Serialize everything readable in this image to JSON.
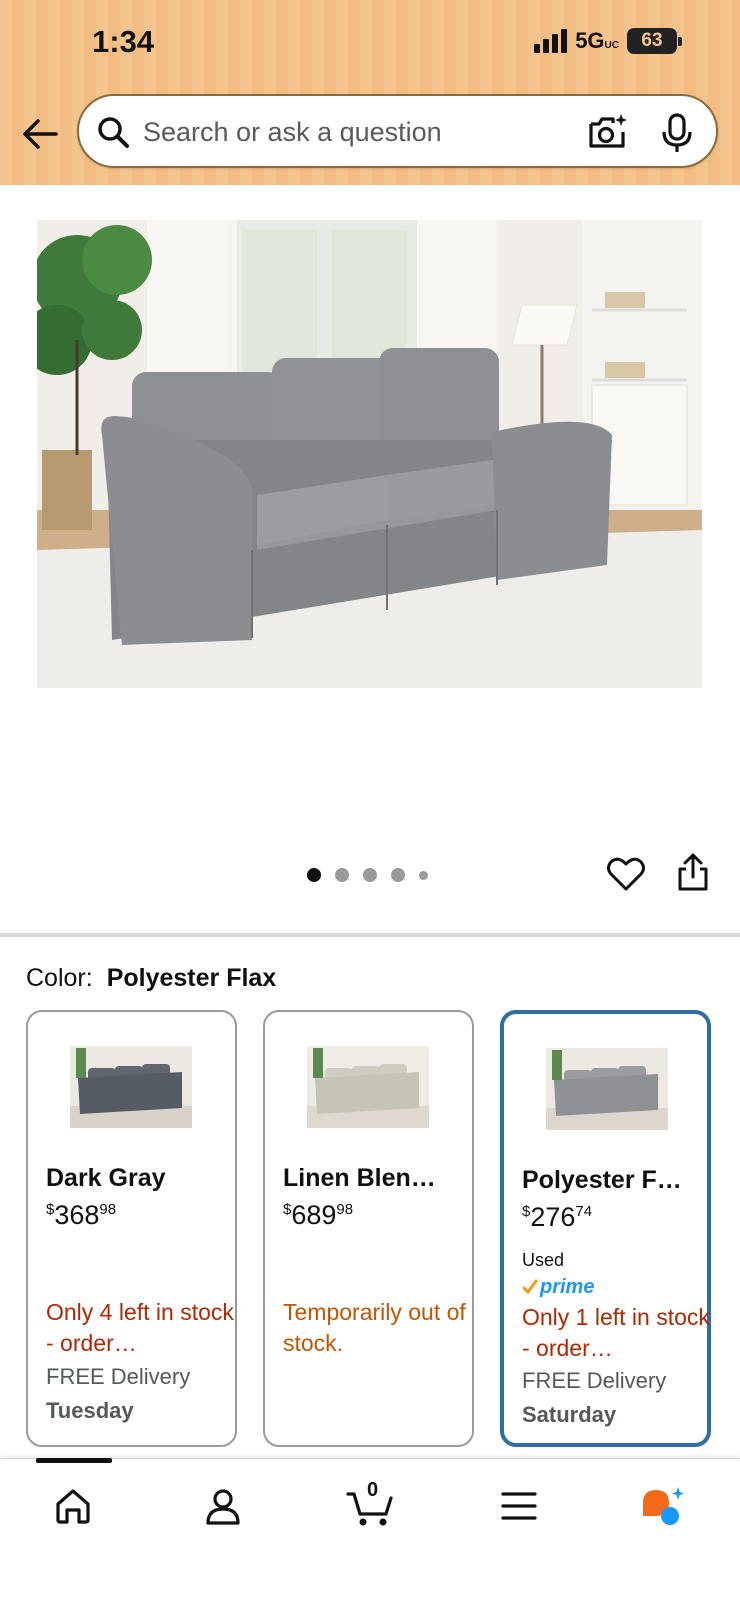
{
  "status_bar": {
    "time": "1:34",
    "network": "5G",
    "network_suffix": "UC",
    "battery": "63"
  },
  "search": {
    "placeholder": "Search or ask a question"
  },
  "carousel": {
    "slide_count": 5,
    "active_index": 0
  },
  "color_selector": {
    "label": "Color:",
    "selected": "Polyester Flax",
    "options": [
      {
        "name": "Dark Gray",
        "price_dollars": "368",
        "price_cents": "98",
        "condition": "",
        "prime": false,
        "stock": "Only 4 left in stock - order…",
        "stock_color": "#b12704",
        "delivery": "FREE Delivery",
        "delivery_day": "Tuesday",
        "selected": false,
        "swatch": "#5f6670"
      },
      {
        "name": "Linen Blen…",
        "price_dollars": "689",
        "price_cents": "98",
        "condition": "",
        "prime": false,
        "stock": "Temporarily out of stock.",
        "stock_color": "#c45500",
        "delivery": "",
        "delivery_day": "",
        "selected": false,
        "swatch": "#cdcbbd"
      },
      {
        "name": "Polyester F…",
        "price_dollars": "276",
        "price_cents": "74",
        "condition": "Used",
        "prime": true,
        "prime_label": "prime",
        "stock": "Only 1 left in stock - order…",
        "stock_color": "#b12704",
        "delivery": "FREE Delivery",
        "delivery_day": "Saturday",
        "selected": true,
        "swatch": "#9a9c9f"
      }
    ]
  },
  "bottom_nav": {
    "cart_count": "0"
  },
  "colors": {
    "header_bg": "#f5c48c",
    "accent_blue": "#2d6ea3",
    "stock_red": "#b12704",
    "stock_orange": "#c45500",
    "prime_blue": "#1a98ff"
  }
}
